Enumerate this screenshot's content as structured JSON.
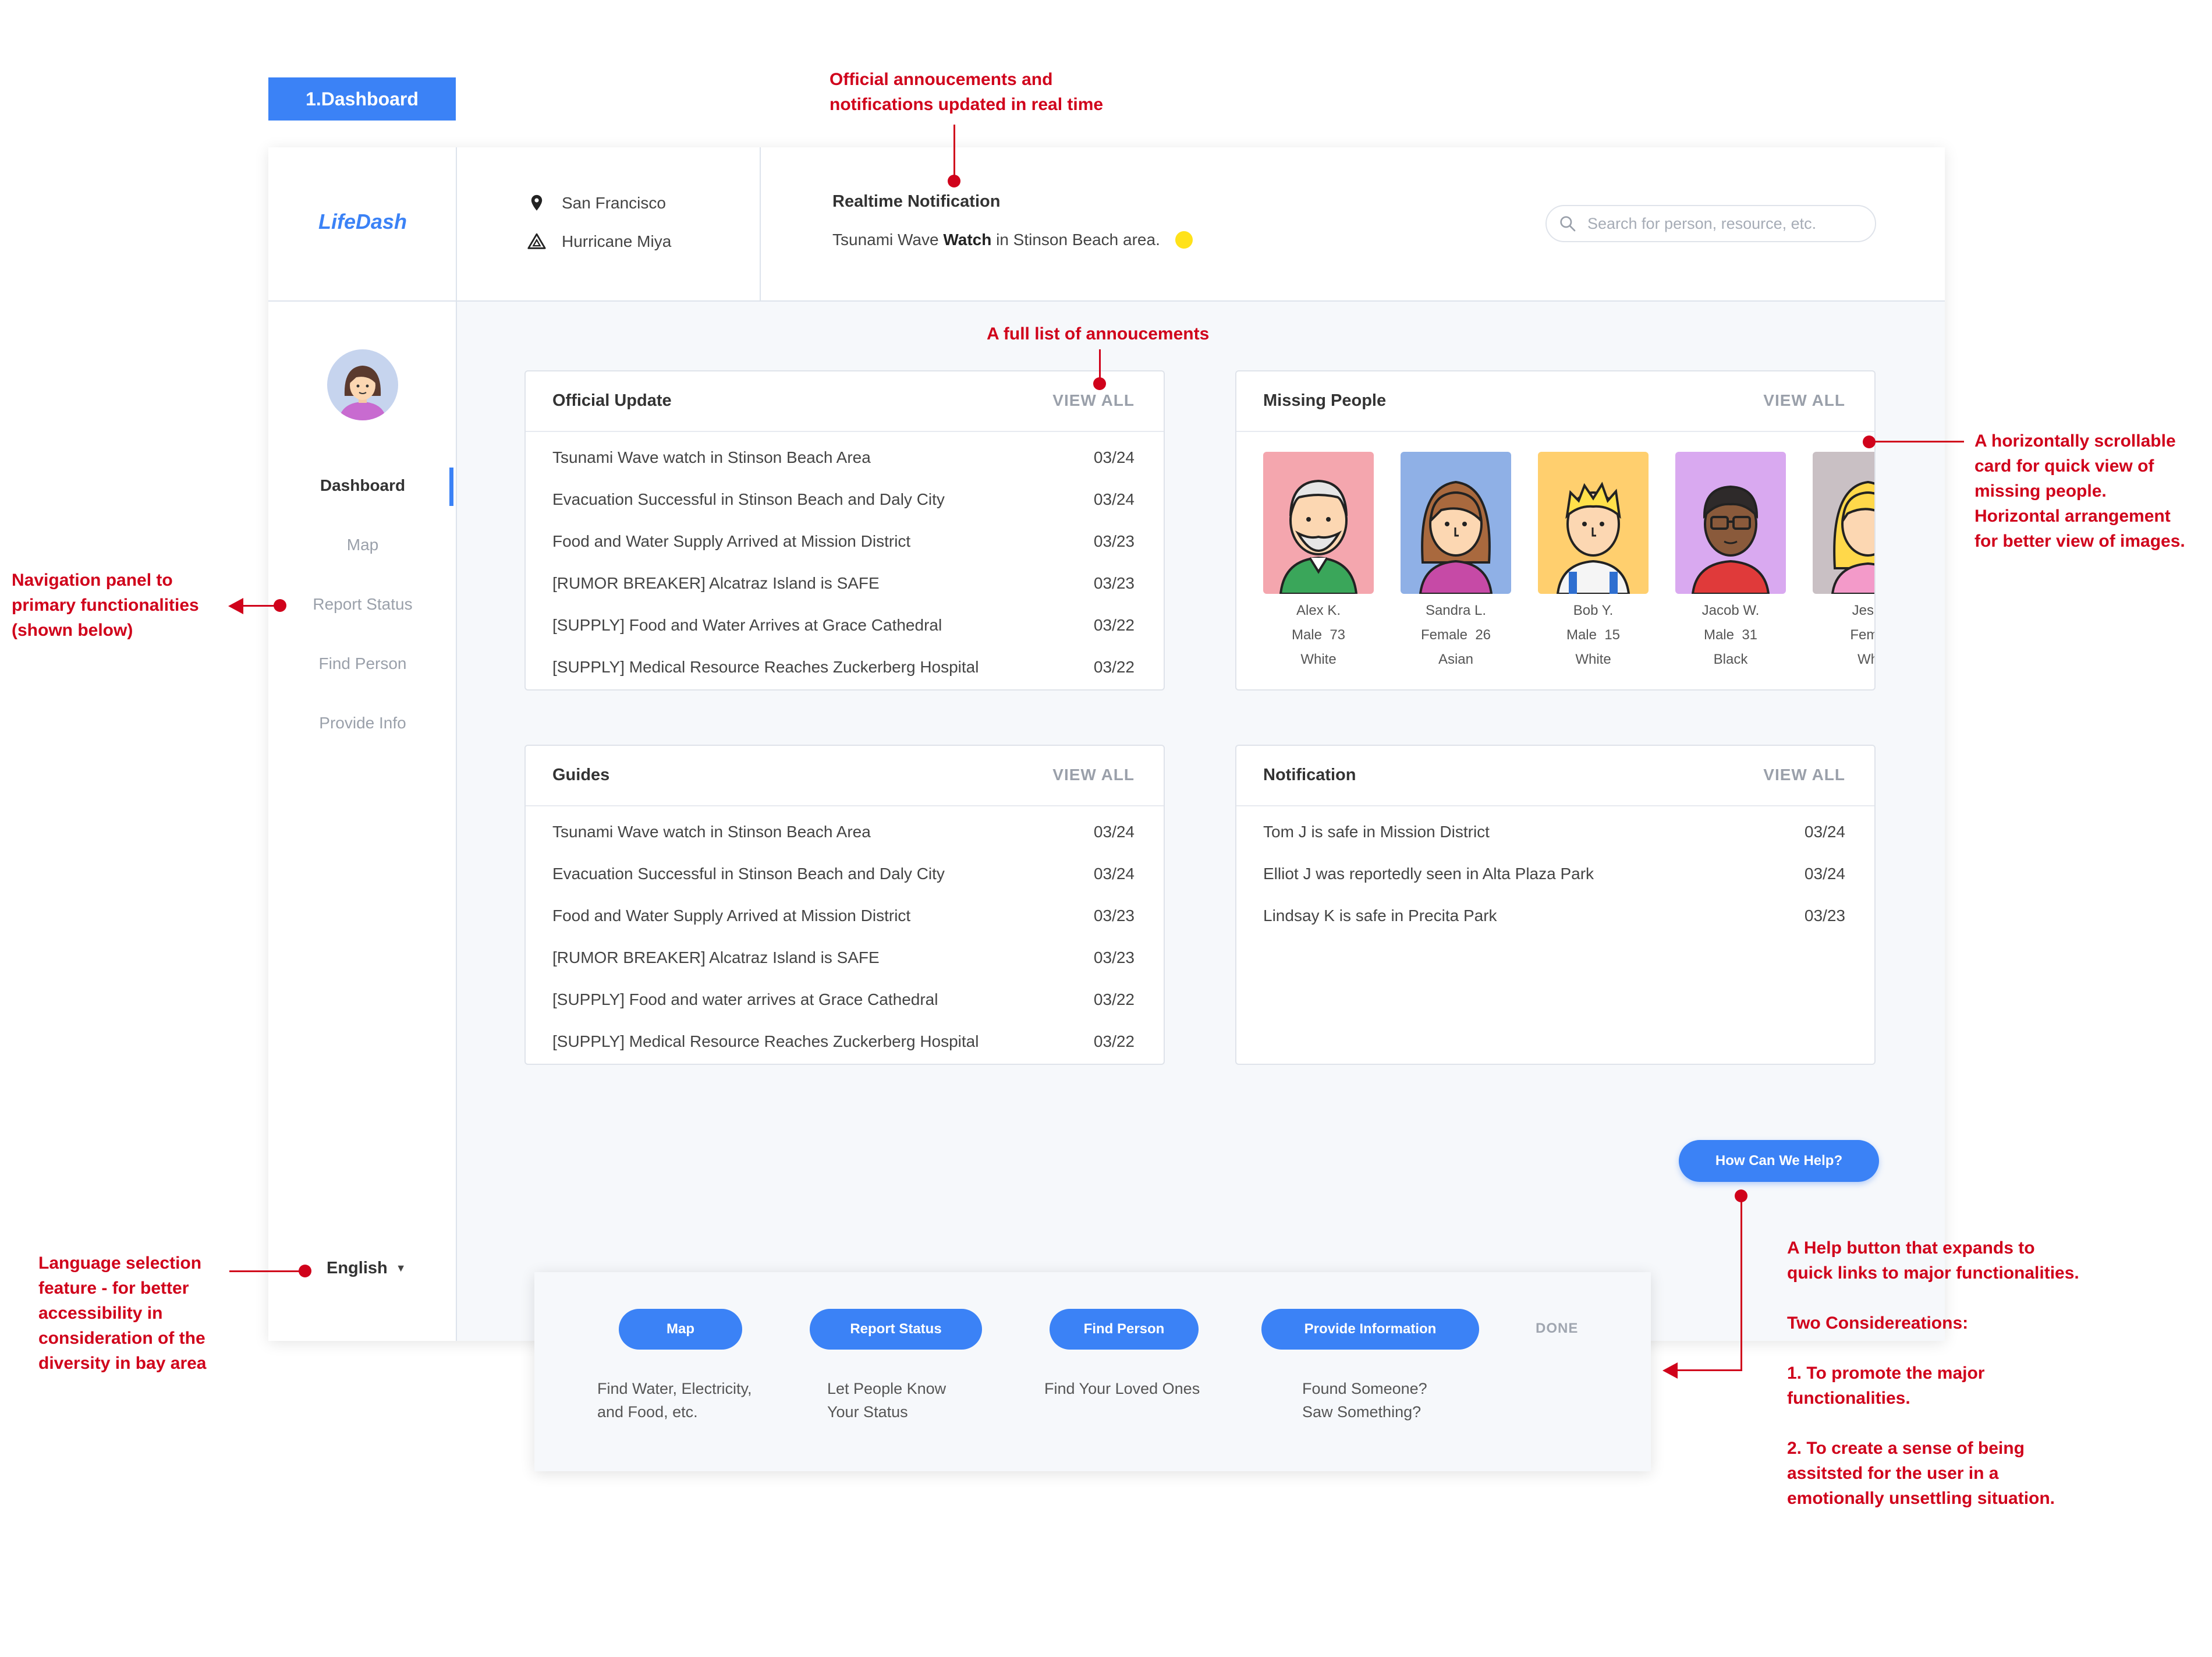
{
  "screen_label": "1.Dashboard",
  "app": {
    "logo": "LifeDash"
  },
  "header": {
    "location": "San Francisco",
    "event": "Hurricane Miya",
    "realtime": {
      "title": "Realtime Notification",
      "text_before": "Tsunami Wave ",
      "text_bold": "Watch",
      "text_after": " in Stinson Beach area.",
      "status_color": "#ffe21a"
    },
    "search": {
      "placeholder": "Search for person, resource, etc.",
      "value": ""
    }
  },
  "sidebar": {
    "items": [
      {
        "label": "Dashboard",
        "active": true
      },
      {
        "label": "Map",
        "active": false
      },
      {
        "label": "Report Status",
        "active": false
      },
      {
        "label": "Find Person",
        "active": false
      },
      {
        "label": "Provide Info",
        "active": false
      }
    ],
    "language": "English"
  },
  "official_update": {
    "title": "Official Update",
    "view_all": "VIEW ALL",
    "rows": [
      {
        "text": "Tsunami Wave watch in Stinson Beach Area",
        "date": "03/24"
      },
      {
        "text": "Evacuation Successful in Stinson Beach and Daly City",
        "date": "03/24"
      },
      {
        "text": "Food and Water Supply Arrived at Mission District",
        "date": "03/23"
      },
      {
        "text": "[RUMOR BREAKER] Alcatraz Island is SAFE",
        "date": "03/23"
      },
      {
        "text": "[SUPPLY] Food and Water Arrives at Grace Cathedral",
        "date": "03/22"
      },
      {
        "text": "[SUPPLY] Medical Resource Reaches Zuckerberg Hospital",
        "date": "03/22"
      }
    ]
  },
  "missing_people": {
    "title": "Missing People",
    "view_all": "VIEW ALL",
    "people": [
      {
        "name": "Alex K.",
        "sex": "Male",
        "age": "73",
        "race": "White",
        "bg": "#f4a6ae"
      },
      {
        "name": "Sandra L.",
        "sex": "Female",
        "age": "26",
        "race": "Asian",
        "bg": "#8fb0e6"
      },
      {
        "name": "Bob Y.",
        "sex": "Male",
        "age": "15",
        "race": "White",
        "bg": "#ffcf6e"
      },
      {
        "name": "Jacob W.",
        "sex": "Male",
        "age": "31",
        "race": "Black",
        "bg": "#d9a9f0"
      },
      {
        "name": "Jessi",
        "sex": "Fema",
        "age": "",
        "race": "Wh",
        "bg": "#c9c0c4"
      }
    ]
  },
  "guides": {
    "title": "Guides",
    "view_all": "VIEW ALL",
    "rows": [
      {
        "text": "Tsunami Wave watch in Stinson Beach Area",
        "date": "03/24"
      },
      {
        "text": "Evacuation Successful in Stinson Beach and Daly City",
        "date": "03/24"
      },
      {
        "text": "Food and Water Supply Arrived at Mission District",
        "date": "03/23"
      },
      {
        "text": "[RUMOR BREAKER] Alcatraz Island is SAFE",
        "date": "03/23"
      },
      {
        "text": "[SUPPLY] Food and water arrives at Grace Cathedral",
        "date": "03/22"
      },
      {
        "text": "[SUPPLY] Medical Resource Reaches Zuckerberg Hospital",
        "date": "03/22"
      }
    ]
  },
  "notification": {
    "title": "Notification",
    "view_all": "VIEW ALL",
    "rows": [
      {
        "text": "Tom J is safe in Mission District",
        "date": "03/24"
      },
      {
        "text": "Elliot J was reportedly seen in Alta Plaza Park",
        "date": "03/24"
      },
      {
        "text": "Lindsay K is safe in Precita Park",
        "date": "03/23"
      }
    ]
  },
  "help": {
    "button": "How Can We Help?",
    "links": [
      {
        "label": "Map",
        "desc1": "Find Water, Electricity,",
        "desc2": "and Food, etc."
      },
      {
        "label": "Report Status",
        "desc1": "Let People Know",
        "desc2": "Your Status"
      },
      {
        "label": "Find Person",
        "desc1": "Find Your Loved Ones",
        "desc2": ""
      },
      {
        "label": "Provide Information",
        "desc1": "Found Someone?",
        "desc2": "Saw Something?"
      }
    ],
    "done": "DONE"
  },
  "annotations": {
    "realtime": [
      "Official annoucements and",
      "notifications updated in real time"
    ],
    "full_list": "A full list of annoucements",
    "missing": [
      "A horizontally scrollable",
      "card for quick view of",
      "missing people.",
      "Horizontal arrangement",
      "for better view of images."
    ],
    "nav": [
      "Navigation panel to",
      "primary functionalities",
      "(shown below)"
    ],
    "language": [
      "Language selection",
      "feature - for better",
      "accessibility in",
      "consideration of the",
      "diversity in bay area"
    ],
    "help": [
      "A Help button that expands to",
      "quick links to major functionalities.",
      "",
      "Two Considereations:",
      "",
      "1. To promote the major",
      "functionalities.",
      "",
      "2. To create a sense of being",
      "assitsted for the user in a",
      "emotionally unsettling situation."
    ]
  },
  "colors": {
    "accent": "#3b82f6",
    "annotation": "#d0021b",
    "panel_bg": "#f6f8fb"
  }
}
